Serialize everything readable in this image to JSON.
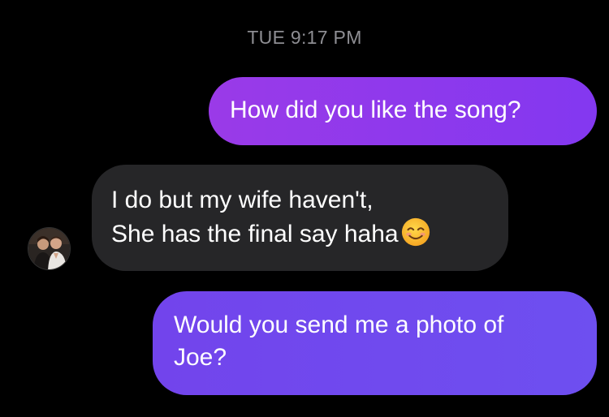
{
  "thread": {
    "timestamp": "TUE 9:17 PM"
  },
  "messages": [
    {
      "direction": "outgoing",
      "lines": [
        "How did you like the song?"
      ]
    },
    {
      "direction": "incoming",
      "lines": [
        "I do but my wife haven't,",
        "She has the final say haha"
      ],
      "emoji": "smiling-face-emoji"
    },
    {
      "direction": "outgoing",
      "lines": [
        "Would you send me a photo of",
        "Joe?"
      ]
    }
  ],
  "colors": {
    "background": "#000000",
    "outgoing_bubble_top": "#9a3ae8",
    "outgoing_bubble_bottom": "#6e4ff0",
    "incoming_bubble": "#262628",
    "timestamp_text": "#8e8e93",
    "message_text": "#ffffff"
  }
}
